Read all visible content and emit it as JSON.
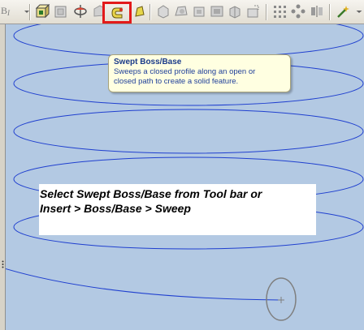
{
  "toolbar": {
    "left_label": "B",
    "left_sub": "I",
    "buttons": [
      {
        "name": "extruded-boss-base",
        "icon": "extrude-boss-icon"
      },
      {
        "name": "revolved-boss-base",
        "icon": "revolve-boss-icon"
      },
      {
        "name": "lofted-boss-base",
        "icon": "loft-boss-icon"
      },
      {
        "name": "swept-boss-base",
        "icon": "swept-boss-icon",
        "highlighted": true
      },
      {
        "name": "thicken",
        "icon": "thicken-icon"
      },
      {
        "name": "extruded-cut",
        "icon": "extrude-cut-icon"
      },
      {
        "name": "revolved-cut",
        "icon": "revolve-cut-icon"
      },
      {
        "name": "lofted-cut",
        "icon": "loft-cut-icon"
      },
      {
        "name": "swept-cut",
        "icon": "swept-cut-icon"
      },
      {
        "name": "shell",
        "icon": "shell-icon"
      },
      {
        "name": "linear-pattern",
        "icon": "linear-pattern-icon"
      },
      {
        "name": "circular-pattern",
        "icon": "circular-pattern-icon"
      },
      {
        "name": "mirror",
        "icon": "mirror-icon"
      },
      {
        "name": "instant3d",
        "icon": "wand-icon"
      }
    ]
  },
  "tooltip": {
    "title": "Swept Boss/Base",
    "description_line1": "Sweeps a closed profile along an open or",
    "description_line2": "closed path to create a solid feature."
  },
  "annotation": {
    "line1": "Select Swept Boss/Base from Tool bar or",
    "line2": "Insert > Boss/Base > Sweep"
  },
  "colors": {
    "viewport_bg": "#b3c9e3",
    "helix": "#1f3fcf",
    "highlight": "#e21a1a",
    "profile_circle": "#7f7f7f"
  }
}
